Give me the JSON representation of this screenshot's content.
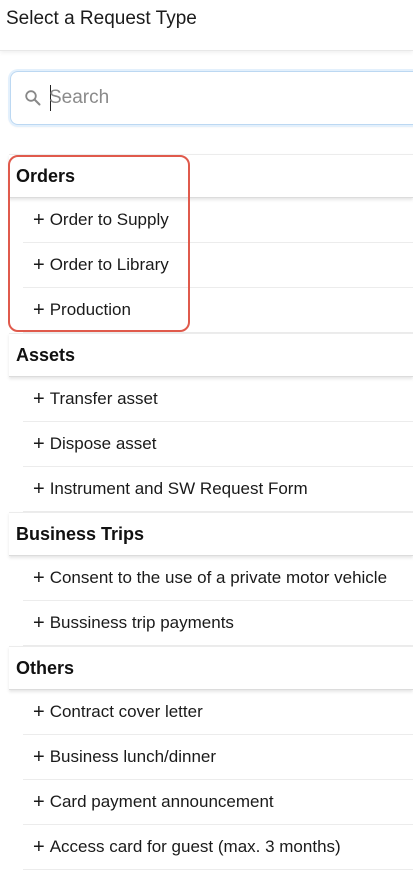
{
  "header": {
    "title": "Select a Request Type"
  },
  "search": {
    "placeholder": "Search"
  },
  "groups": [
    {
      "label": "Orders",
      "items": [
        "Order to Supply",
        "Order to Library",
        "Production"
      ]
    },
    {
      "label": "Assets",
      "items": [
        "Transfer asset",
        "Dispose asset",
        "Instrument and SW Request Form"
      ]
    },
    {
      "label": "Business Trips",
      "items": [
        "Consent to the use of a private motor vehicle",
        "Bussiness trip payments"
      ]
    },
    {
      "label": "Others",
      "items": [
        "Contract cover letter",
        "Business lunch/dinner",
        "Card payment announcement",
        "Access card for guest (max. 3 months)"
      ]
    }
  ],
  "item_prefix": "+",
  "colors": {
    "highlight": "#e05a4c",
    "search_focus": "#bcd8f2"
  }
}
